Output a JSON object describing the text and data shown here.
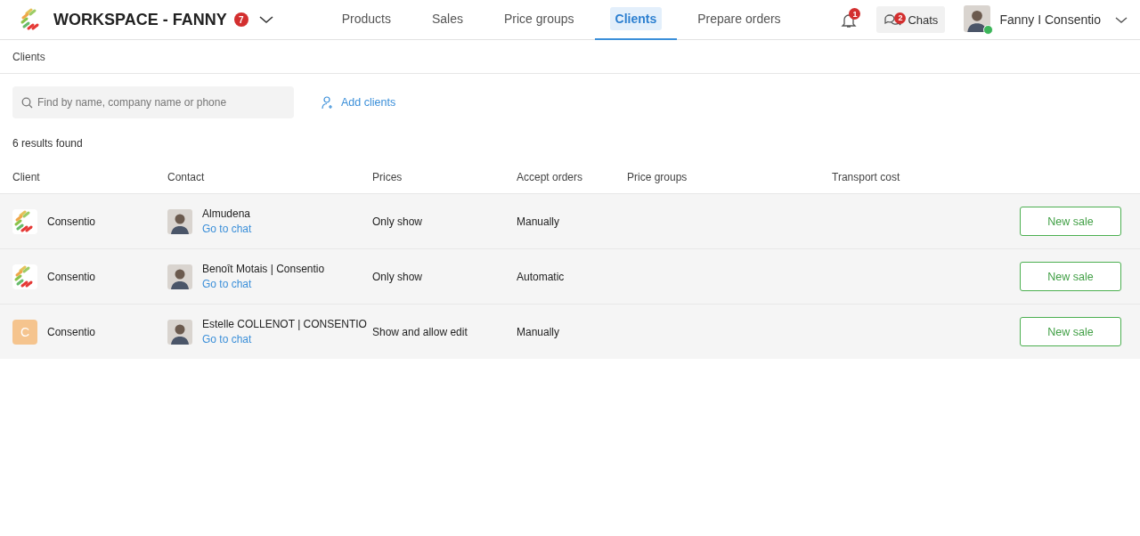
{
  "header": {
    "workspace": "WORKSPACE - FANNY",
    "workspace_badge": "7",
    "nav": [
      {
        "label": "Products",
        "selected": false
      },
      {
        "label": "Sales",
        "selected": false
      },
      {
        "label": "Price groups",
        "selected": false
      },
      {
        "label": "Clients",
        "selected": true
      },
      {
        "label": "Prepare orders",
        "selected": false
      }
    ],
    "notifications_badge": "1",
    "chats": {
      "label": "Chats",
      "badge": "2"
    },
    "user": {
      "name": "Fanny I Consentio",
      "online": true
    }
  },
  "breadcrumb": "Clients",
  "search": {
    "placeholder": "Find by name, company name or phone"
  },
  "add_clients": "Add clients",
  "results": "6 results found",
  "table": {
    "columns": [
      "Client",
      "Contact",
      "Prices",
      "Accept orders",
      "Price groups",
      "Transport cost"
    ],
    "rows": [
      {
        "logo": {
          "kind": "logo"
        },
        "client": "Consentio",
        "contact": "Almudena",
        "chat_link": "Go to chat",
        "prices": "Only show",
        "accept_orders": "Manually",
        "action": "New sale"
      },
      {
        "logo": {
          "kind": "logo"
        },
        "client": "Consentio",
        "contact": "Benoît Motais | Consentio",
        "chat_link": "Go to chat",
        "prices": "Only show",
        "accept_orders": "Automatic",
        "action": "New sale"
      },
      {
        "logo": {
          "kind": "letter",
          "letter": "C",
          "color": "#f5c48e"
        },
        "client": "Consentio",
        "contact": "Estelle COLLENOT | CONSENTIO",
        "chat_link": "Go to chat",
        "prices": "Show and allow edit",
        "accept_orders": "Manually",
        "action": "New sale"
      }
    ]
  }
}
